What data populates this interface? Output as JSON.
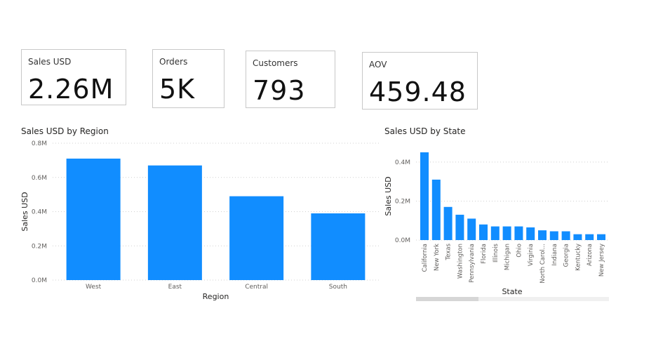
{
  "cards": [
    {
      "label": "Sales USD",
      "value": "2.26M"
    },
    {
      "label": "Orders",
      "value": "5K"
    },
    {
      "label": "Customers",
      "value": "793"
    },
    {
      "label": "AOV",
      "value": "459.48"
    }
  ],
  "bar_color": "#118DFF",
  "chart_data": [
    {
      "type": "bar",
      "title": "Sales USD by Region",
      "xlabel": "Region",
      "ylabel": "Sales USD",
      "categories": [
        "West",
        "East",
        "Central",
        "South"
      ],
      "values": [
        0.71,
        0.67,
        0.49,
        0.39
      ],
      "unit": "M",
      "ylim": [
        0,
        0.8
      ],
      "yticks": [
        "0.0M",
        "0.2M",
        "0.4M",
        "0.6M",
        "0.8M"
      ],
      "grid": true
    },
    {
      "type": "bar",
      "title": "Sales USD by State",
      "xlabel": "State",
      "ylabel": "Sales USD",
      "categories": [
        "California",
        "New York",
        "Texas",
        "Washington",
        "Pennsylvania",
        "Florida",
        "Illinois",
        "Michigan",
        "Ohio",
        "Virginia",
        "North Carol...",
        "Indiana",
        "Georgia",
        "Kentucky",
        "Arizona",
        "New Jersey"
      ],
      "values": [
        0.45,
        0.31,
        0.17,
        0.13,
        0.11,
        0.08,
        0.07,
        0.07,
        0.07,
        0.065,
        0.05,
        0.045,
        0.045,
        0.03,
        0.03,
        0.03
      ],
      "unit": "M",
      "ylim": [
        0,
        0.45
      ],
      "yticks": [
        "0.0M",
        "0.2M",
        "0.4M"
      ],
      "grid": true
    }
  ]
}
